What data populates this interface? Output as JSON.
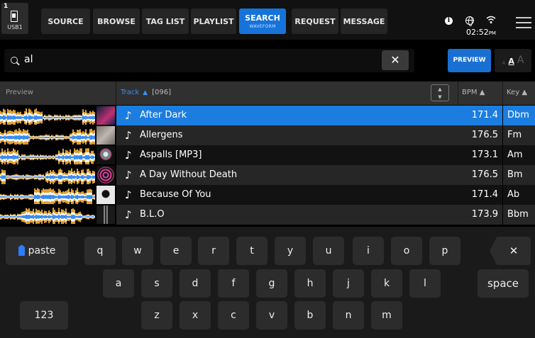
{
  "device": {
    "slot": "1",
    "label": "USB1"
  },
  "nav": {
    "tabs": [
      {
        "label": "SOURCE"
      },
      {
        "label": "BROWSE"
      },
      {
        "label": "TAG LIST"
      },
      {
        "label": "PLAYLIST"
      },
      {
        "label": "SEARCH",
        "sub": "WAVEFORM",
        "active": true
      },
      {
        "label": "REQUEST"
      },
      {
        "label": "MESSAGE"
      }
    ]
  },
  "status": {
    "time": "02:52",
    "ampm": "PM"
  },
  "search": {
    "query": "al",
    "clear_symbol": "✕",
    "preview_label": "PREVIEW"
  },
  "font_size": {
    "small": "A",
    "medium": "A",
    "large": "A"
  },
  "table": {
    "columns": {
      "preview": "Preview",
      "track": "Track",
      "count": "[096]",
      "bpm": "BPM",
      "key": "Key"
    },
    "sort_arrow": "▲",
    "rows": [
      {
        "title": "After Dark",
        "bpm": "171.4",
        "key": "Dbm",
        "selected": true
      },
      {
        "title": "Allergens",
        "bpm": "176.5",
        "key": "Fm"
      },
      {
        "title": "Aspalls [MP3]",
        "bpm": "173.1",
        "key": "Am"
      },
      {
        "title": "A Day Without Death",
        "bpm": "176.5",
        "key": "Bm"
      },
      {
        "title": "Because Of You",
        "bpm": "171.4",
        "key": "Ab"
      },
      {
        "title": "B.L.O",
        "bpm": "173.9",
        "key": "Bbm"
      }
    ]
  },
  "keyboard": {
    "paste": "paste",
    "row1": [
      "q",
      "w",
      "e",
      "r",
      "t",
      "y",
      "u",
      "i",
      "o",
      "p"
    ],
    "row2": [
      "a",
      "s",
      "d",
      "f",
      "g",
      "h",
      "j",
      "k",
      "l"
    ],
    "row3": [
      "z",
      "x",
      "c",
      "v",
      "b",
      "n",
      "m"
    ],
    "backspace": "✕",
    "space": "space",
    "numbers": "123"
  },
  "colors": {
    "accent": "#1b7de0",
    "waveform_orange": "#e0a030",
    "waveform_blue": "#3a8cf0"
  }
}
